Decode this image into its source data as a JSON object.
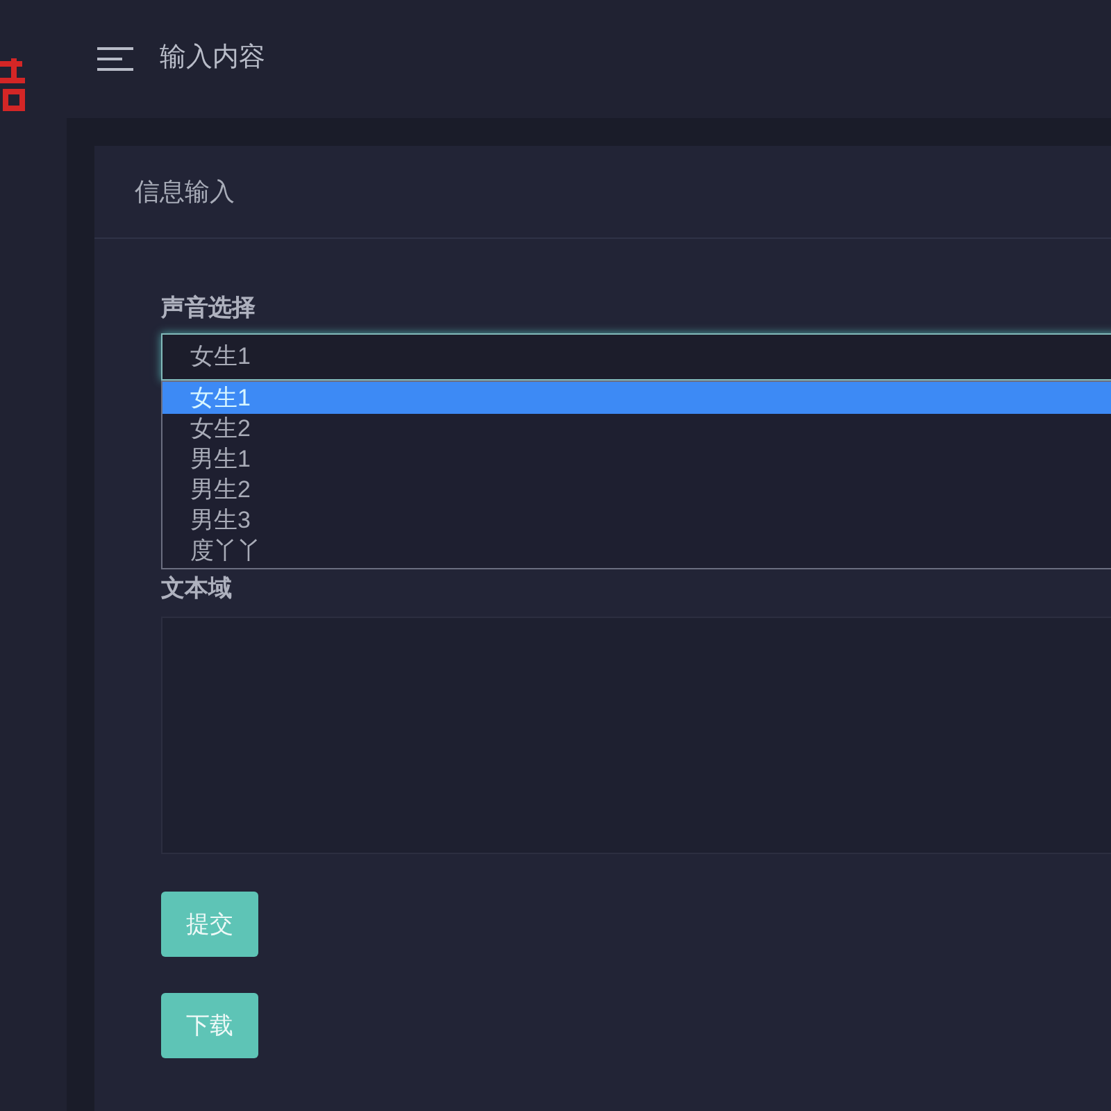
{
  "header": {
    "title": "输入内容"
  },
  "card": {
    "title": "信息输入",
    "fields": [
      {
        "kind": "select",
        "label": "声音选择",
        "value": "女生1",
        "expanded": true,
        "options": [
          {
            "label": "女生1",
            "selected": true
          },
          {
            "label": "女生2",
            "selected": false
          },
          {
            "label": "男生1",
            "selected": false
          },
          {
            "label": "男生2",
            "selected": false
          },
          {
            "label": "男生3",
            "selected": false
          },
          {
            "label": "度丫丫",
            "selected": false
          }
        ]
      },
      {
        "kind": "textarea",
        "label": "文本域"
      }
    ],
    "buttons": [
      {
        "label": "提交"
      },
      {
        "label": "下载"
      }
    ]
  }
}
